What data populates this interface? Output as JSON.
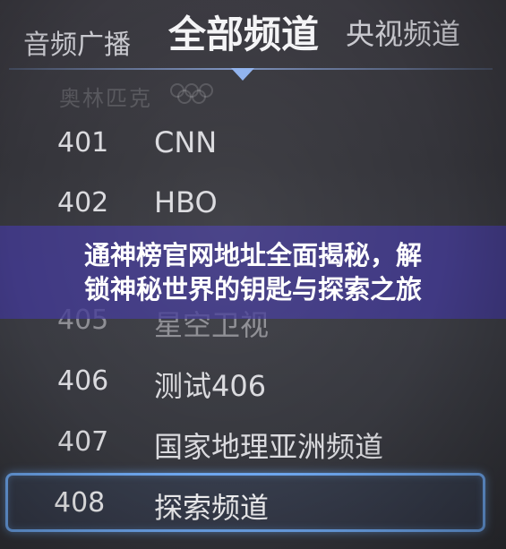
{
  "tabs": {
    "left": "音频广播",
    "center": "全部频道",
    "right": "央视频道"
  },
  "ghost_logo": "奥林匹克",
  "channels": [
    {
      "number": "401",
      "name": "CNN"
    },
    {
      "number": "402",
      "name": "HBO"
    },
    {
      "number": "405",
      "name": "星空卫视"
    },
    {
      "number": "406",
      "name": "测试406"
    },
    {
      "number": "407",
      "name": "国家地理亚洲频道"
    },
    {
      "number": "408",
      "name": "探索频道"
    }
  ],
  "banner": {
    "line1": "通神榜官网地址全面揭秘，解",
    "line2": "锁神秘世界的钥匙与探索之旅"
  },
  "colors": {
    "highlight": "#6ea7ef",
    "banner": "#423a96"
  }
}
